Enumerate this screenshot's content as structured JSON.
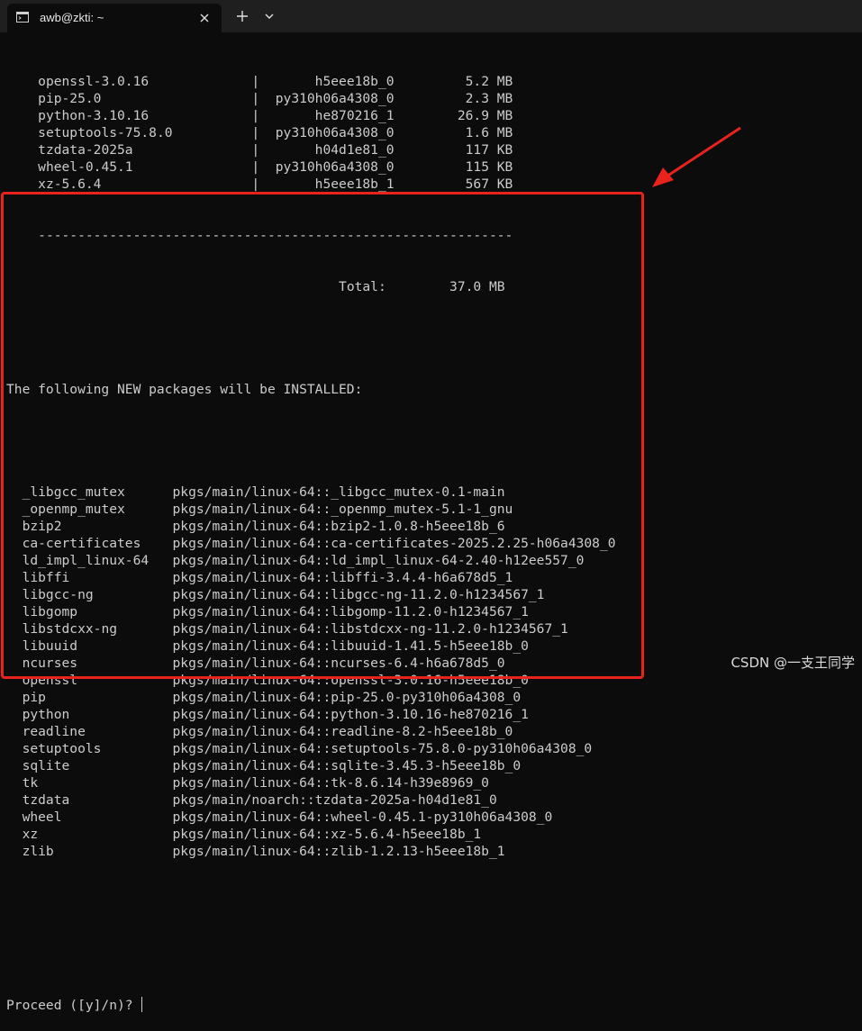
{
  "window": {
    "tab_title": "awb@zkti: ~"
  },
  "icons": {
    "terminal": "terminal-icon",
    "close": "close-icon",
    "new_tab": "plus-icon",
    "dropdown": "chevron-down-icon",
    "arrow": "red-arrow-annotation"
  },
  "colors": {
    "terminal_bg": "#0c0c0c",
    "terminal_fg": "#cccccc",
    "highlight": "#e8221c"
  },
  "download_table": {
    "rows": [
      {
        "name": "openssl-3.0.16",
        "build": "h5eee18b_0",
        "size": "5.2 MB"
      },
      {
        "name": "pip-25.0",
        "build": "py310h06a4308_0",
        "size": "2.3 MB"
      },
      {
        "name": "python-3.10.16",
        "build": "he870216_1",
        "size": "26.9 MB"
      },
      {
        "name": "setuptools-75.8.0",
        "build": "py310h06a4308_0",
        "size": "1.6 MB"
      },
      {
        "name": "tzdata-2025a",
        "build": "h04d1e81_0",
        "size": "117 KB"
      },
      {
        "name": "wheel-0.45.1",
        "build": "py310h06a4308_0",
        "size": "115 KB"
      },
      {
        "name": "xz-5.6.4",
        "build": "h5eee18b_1",
        "size": "567 KB"
      }
    ],
    "separator": "------------------------------------------------------------",
    "total_label": "Total:",
    "total_value": "37.0 MB"
  },
  "install_header": "The following NEW packages will be INSTALLED:",
  "packages": [
    {
      "name": "_libgcc_mutex",
      "spec": "pkgs/main/linux-64::_libgcc_mutex-0.1-main"
    },
    {
      "name": "_openmp_mutex",
      "spec": "pkgs/main/linux-64::_openmp_mutex-5.1-1_gnu"
    },
    {
      "name": "bzip2",
      "spec": "pkgs/main/linux-64::bzip2-1.0.8-h5eee18b_6"
    },
    {
      "name": "ca-certificates",
      "spec": "pkgs/main/linux-64::ca-certificates-2025.2.25-h06a4308_0"
    },
    {
      "name": "ld_impl_linux-64",
      "spec": "pkgs/main/linux-64::ld_impl_linux-64-2.40-h12ee557_0"
    },
    {
      "name": "libffi",
      "spec": "pkgs/main/linux-64::libffi-3.4.4-h6a678d5_1"
    },
    {
      "name": "libgcc-ng",
      "spec": "pkgs/main/linux-64::libgcc-ng-11.2.0-h1234567_1"
    },
    {
      "name": "libgomp",
      "spec": "pkgs/main/linux-64::libgomp-11.2.0-h1234567_1"
    },
    {
      "name": "libstdcxx-ng",
      "spec": "pkgs/main/linux-64::libstdcxx-ng-11.2.0-h1234567_1"
    },
    {
      "name": "libuuid",
      "spec": "pkgs/main/linux-64::libuuid-1.41.5-h5eee18b_0"
    },
    {
      "name": "ncurses",
      "spec": "pkgs/main/linux-64::ncurses-6.4-h6a678d5_0"
    },
    {
      "name": "openssl",
      "spec": "pkgs/main/linux-64::openssl-3.0.16-h5eee18b_0"
    },
    {
      "name": "pip",
      "spec": "pkgs/main/linux-64::pip-25.0-py310h06a4308_0"
    },
    {
      "name": "python",
      "spec": "pkgs/main/linux-64::python-3.10.16-he870216_1"
    },
    {
      "name": "readline",
      "spec": "pkgs/main/linux-64::readline-8.2-h5eee18b_0"
    },
    {
      "name": "setuptools",
      "spec": "pkgs/main/linux-64::setuptools-75.8.0-py310h06a4308_0"
    },
    {
      "name": "sqlite",
      "spec": "pkgs/main/linux-64::sqlite-3.45.3-h5eee18b_0"
    },
    {
      "name": "tk",
      "spec": "pkgs/main/linux-64::tk-8.6.14-h39e8969_0"
    },
    {
      "name": "tzdata",
      "spec": "pkgs/main/noarch::tzdata-2025a-h04d1e81_0"
    },
    {
      "name": "wheel",
      "spec": "pkgs/main/linux-64::wheel-0.45.1-py310h06a4308_0"
    },
    {
      "name": "xz",
      "spec": "pkgs/main/linux-64::xz-5.6.4-h5eee18b_1"
    },
    {
      "name": "zlib",
      "spec": "pkgs/main/linux-64::zlib-1.2.13-h5eee18b_1"
    }
  ],
  "prompt": "Proceed ([y]/n)? ",
  "watermark": "CSDN @一支王同学"
}
